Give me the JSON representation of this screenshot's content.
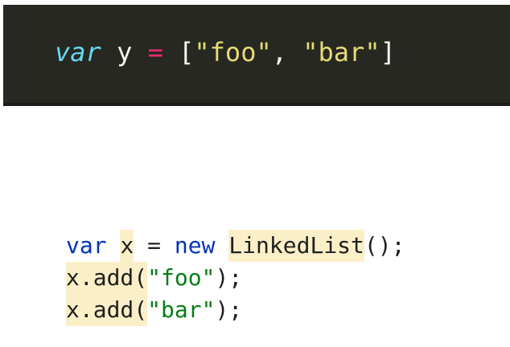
{
  "dark_snippet": {
    "line": {
      "keyword": "var",
      "space1": " ",
      "identifier": "y",
      "space2": " ",
      "operator": "=",
      "space3": " ",
      "open_bracket": "[",
      "string1": "\"foo\"",
      "comma": ", ",
      "string2": "\"bar\"",
      "close_bracket": "]"
    }
  },
  "light_snippet": {
    "line1": {
      "keyword_var": "var",
      "sp1": " ",
      "identifier": "x",
      "sp2": " = ",
      "keyword_new": "new",
      "sp3": " ",
      "class_name": "LinkedList",
      "tail": "();"
    },
    "line2": {
      "identifier": "x",
      "method": ".add(",
      "string": "\"foo\"",
      "tail": ");"
    },
    "line3": {
      "identifier": "x",
      "method": ".add(",
      "string": "\"bar\"",
      "tail": ");"
    }
  }
}
